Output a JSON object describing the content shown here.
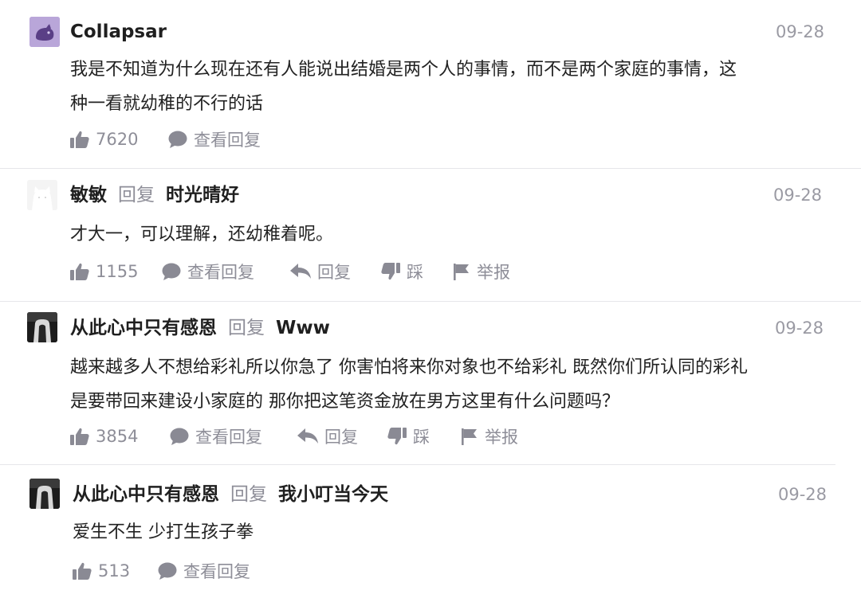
{
  "colors": {
    "text": "#222222",
    "muted": "#8e8e98",
    "icon": "#8a8a94",
    "divider": "#e6e6ea",
    "first_avatar_bg": "#b9a6d9"
  },
  "comments": [
    {
      "avatar_icon": "purple-cat-avatar",
      "author": "Collapsar",
      "date": "09-28",
      "body_lines": [
        "我是不知道为什么现在还有人能说出结婚是两个人的事情，而不是两个家庭的事情，这",
        "种一看就幼稚的不行的话"
      ],
      "likes": "7620",
      "view_replies": "查看回复"
    },
    {
      "avatar_icon": "white-cat-avatar",
      "author": "敏敏",
      "reply_word": "回复",
      "reply_to": "时光晴好",
      "date": "09-28",
      "body_lines": [
        "才大一，可以理解，还幼稚着呢。"
      ],
      "likes": "1155",
      "view_replies": "查看回复",
      "reply": "回复",
      "dislike": "踩",
      "report": "举报"
    },
    {
      "avatar_icon": "dark-photo-avatar",
      "author": "从此心中只有感恩",
      "reply_word": "回复",
      "reply_to": "Www",
      "date": "09-28",
      "body_lines": [
        "越来越多人不想给彩礼所以你急了 你害怕将来你对象也不给彩礼 既然你们所认同的彩礼",
        "是要带回来建设小家庭的 那你把这笔资金放在男方这里有什么问题吗？"
      ],
      "likes": "3854",
      "view_replies": "查看回复",
      "reply": "回复",
      "dislike": "踩",
      "report": "举报"
    },
    {
      "avatar_icon": "dark-photo-avatar",
      "author": "从此心中只有感恩",
      "reply_word": "回复",
      "reply_to": "我小叮当今天",
      "date": "09-28",
      "body_lines": [
        "爱生不生 少打生孩子拳"
      ],
      "likes": "513",
      "view_replies": "查看回复"
    }
  ]
}
